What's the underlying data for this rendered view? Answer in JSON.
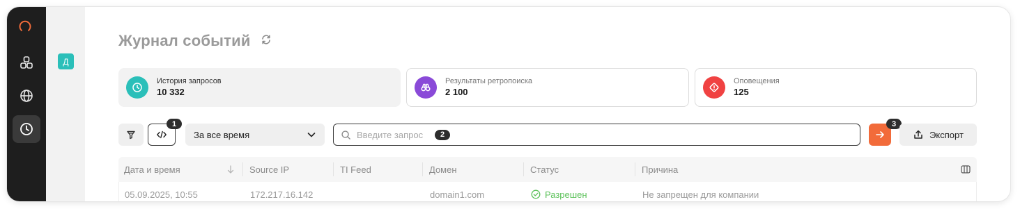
{
  "header": {
    "title": "Журнал событий"
  },
  "org": {
    "initial": "Д"
  },
  "rail": {
    "items": [
      "logo-icon",
      "dashboard-icon",
      "globe-icon",
      "clock-icon"
    ],
    "active": "clock-icon"
  },
  "stats": [
    {
      "label": "История запросов",
      "value": "10 332",
      "icon": "clock-icon",
      "color": "#2bbfb9"
    },
    {
      "label": "Результаты ретропоиска",
      "value": "2 100",
      "icon": "binoculars-icon",
      "color": "#8a4ad8"
    },
    {
      "label": "Оповещения",
      "value": "125",
      "icon": "alert-diamond-icon",
      "color": "#f04242"
    }
  ],
  "toolbar": {
    "time_range": "За все время",
    "search_placeholder": "Введите запрос",
    "export_label": "Экспорт",
    "badges": [
      "1",
      "2",
      "3"
    ]
  },
  "table": {
    "columns": [
      "Дата и время",
      "Source IP",
      "TI Feed",
      "Домен",
      "Статус",
      "Причина"
    ],
    "rows": [
      {
        "datetime": "05.09.2025, 10:55",
        "source_ip": "172.217.16.142",
        "ti_feed": "",
        "domain": "domain1.com",
        "status": "Разрешен",
        "reason": "Не запрещен для компании"
      }
    ]
  },
  "colors": {
    "accent": "#f26b3a",
    "rail": "#1e1e1e",
    "teal": "#2bbfb9",
    "purple": "#8a4ad8",
    "red": "#f04242",
    "success": "#5cc25a"
  }
}
